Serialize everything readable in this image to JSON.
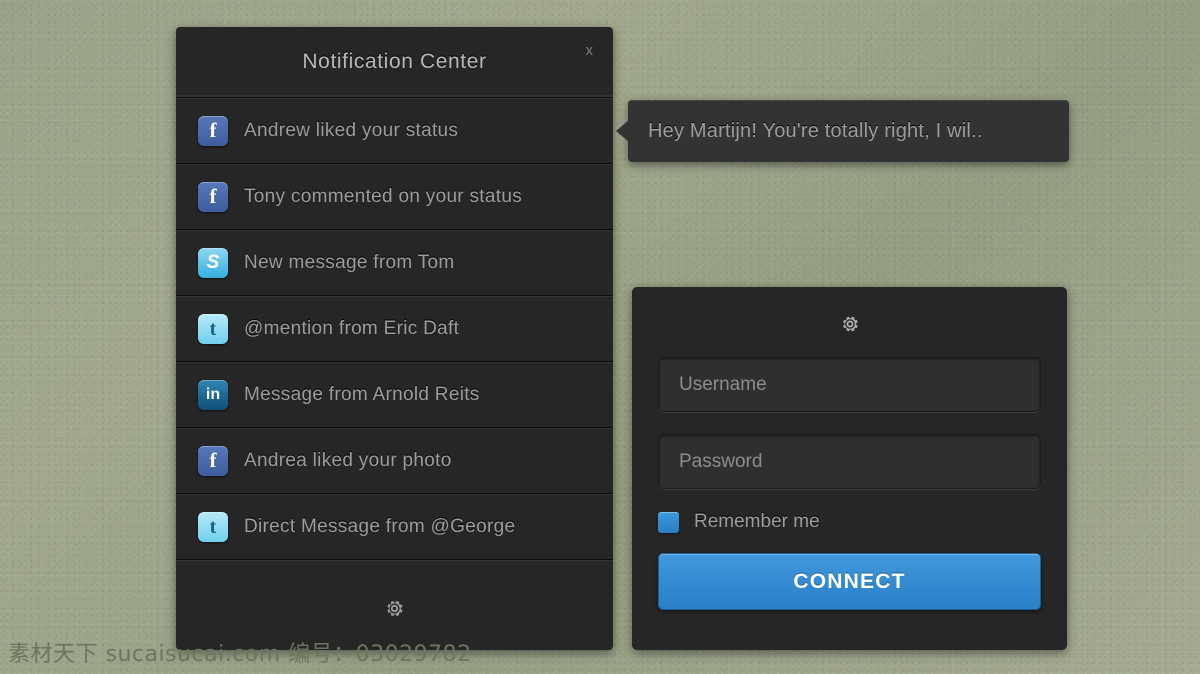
{
  "notification_center": {
    "title": "Notification Center",
    "close_label": "x",
    "settings_icon": "gear-icon",
    "items": [
      {
        "network": "facebook",
        "glyph": "f",
        "text": "Andrew liked your status"
      },
      {
        "network": "facebook",
        "glyph": "f",
        "text": "Tony commented on your status"
      },
      {
        "network": "skype",
        "glyph": "S",
        "text": "New message from Tom"
      },
      {
        "network": "twitter",
        "glyph": "t",
        "text": "@mention from Eric Daft"
      },
      {
        "network": "linkedin",
        "glyph": "in",
        "text": "Message from Arnold Reits"
      },
      {
        "network": "facebook",
        "glyph": "f",
        "text": "Andrea liked your photo"
      },
      {
        "network": "twitter",
        "glyph": "t",
        "text": "Direct Message from @George"
      }
    ]
  },
  "tooltip": {
    "text": "Hey Martijn! You're totally right, I wil.."
  },
  "login_panel": {
    "settings_icon": "gear-icon",
    "username_placeholder": "Username",
    "username_value": "",
    "password_placeholder": "Password",
    "password_value": "",
    "remember_label": "Remember me",
    "remember_checked": true,
    "connect_label": "CONNECT"
  },
  "watermark": {
    "text": "素材天下 sucaisucai.com  编号：03029782"
  },
  "colors": {
    "panel_background": "#262626",
    "page_background": "#97a086",
    "accent_blue": "#3f9ade",
    "text_primary": "#9d9d9d",
    "title_text": "#b9b9b9"
  }
}
